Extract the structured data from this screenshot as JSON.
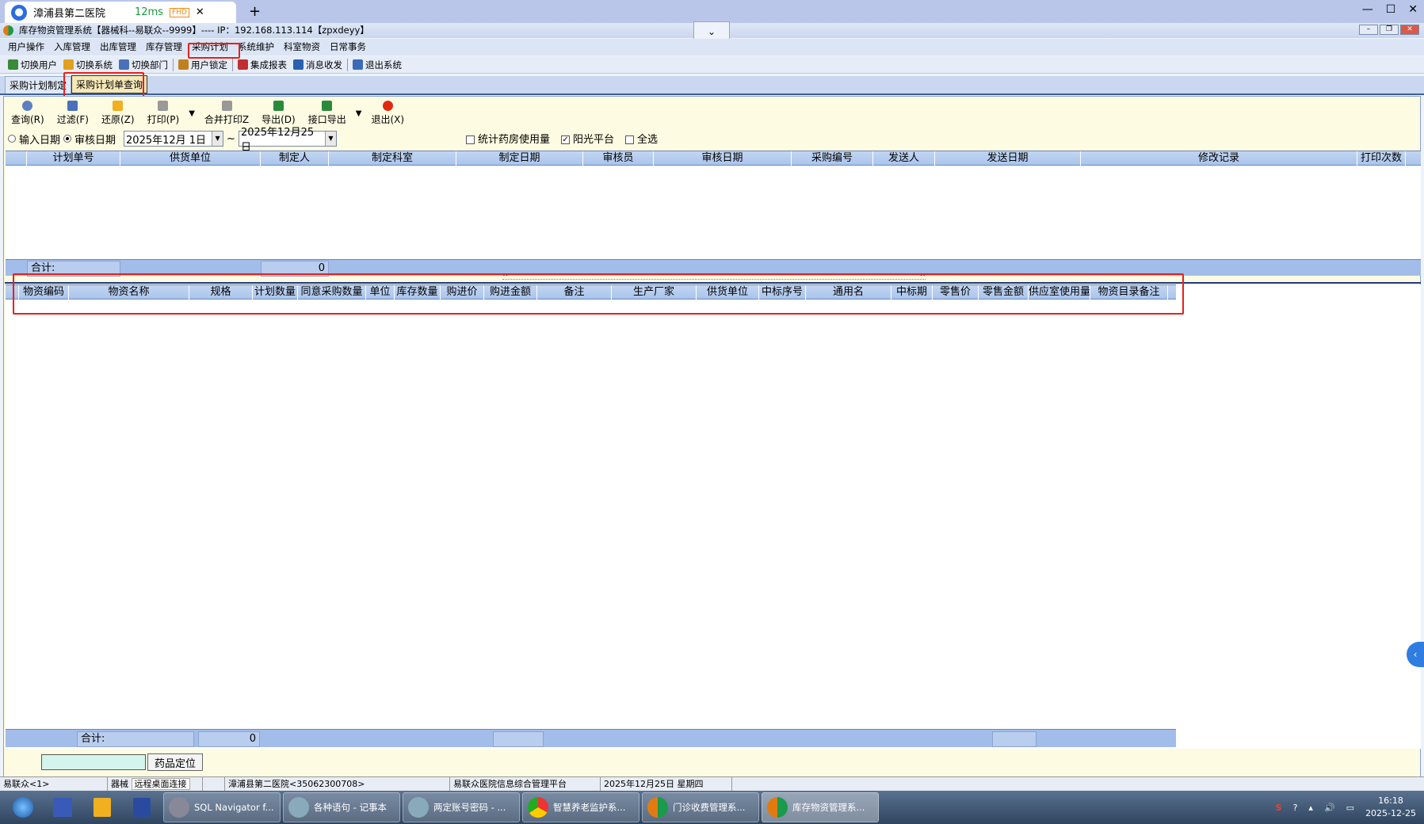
{
  "browser": {
    "tab_title": "漳浦县第二医院",
    "ping": "12ms",
    "quality_badge": "FHD",
    "close": "✕",
    "new_tab": "+",
    "window_controls": [
      "—",
      "☐",
      "✕"
    ]
  },
  "app": {
    "title": "库存物资管理系统【器械科--易联众--9999】---- IP：192.168.113.114【zpxdeyy】",
    "dropdown_icon": "chevron-down"
  },
  "menubar": [
    "用户操作",
    "入库管理",
    "出库管理",
    "库存管理",
    "采购计划",
    "系统维护",
    "科室物资",
    "日常事务"
  ],
  "toolbar1": [
    "切换用户",
    "切换系统",
    "切换部门",
    "用户锁定",
    "集成报表",
    "消息收发",
    "退出系统"
  ],
  "tabs": [
    "采购计划制定",
    "采购计划单查询"
  ],
  "active_tab": 1,
  "toolbar2": {
    "query": "查询(R)",
    "filter": "过滤(F)",
    "restore": "还原(Z)",
    "print": "打印(P)",
    "merge_print": "合并打印Z",
    "export": "导出(D)",
    "api_export": "接口导出",
    "exit": "退出(X)"
  },
  "date_filter": {
    "input_date": "输入日期",
    "audit_date": "审核日期",
    "selected": "审核日期",
    "from": "2025年12月 1日",
    "sep": "~",
    "to": "2025年12月25日"
  },
  "checks": {
    "pharmacy_usage": {
      "label": "统计药房使用量",
      "checked": false
    },
    "sunshine": {
      "label": "阳光平台",
      "checked": true
    },
    "select_all": {
      "label": "全选",
      "checked": false
    }
  },
  "grid1": {
    "columns": [
      "",
      "计划单号",
      "供货单位",
      "制定人",
      "制定科室",
      "制定日期",
      "审核员",
      "审核日期",
      "采购编号",
      "发送人",
      "发送日期",
      "修改记录",
      "打印次数"
    ],
    "rows": [],
    "sum_label": "合计:",
    "sum_value": "0"
  },
  "grid2": {
    "columns": [
      "",
      "物资编码",
      "物资名称",
      "规格",
      "计划数量",
      "同意采购数量",
      "单位",
      "库存数量",
      "购进价",
      "购进金额",
      "备注",
      "生产厂家",
      "供货单位",
      "中标序号",
      "通用名",
      "中标期",
      "零售价",
      "零售金额",
      "供应室使用量",
      "物资目录备注"
    ],
    "rows": [],
    "sum_label": "合计:",
    "sum_value": "0"
  },
  "bottom": {
    "locate_value": "",
    "locate_button": "药品定位"
  },
  "status": [
    "易联众<1>",
    "器械",
    "远程桌面连接",
    "漳浦县第二医院<35062300708>",
    "易联众医院信息综合管理平台",
    "2025年12月25日 星期四",
    ""
  ],
  "taskbar": {
    "items": [
      "SQL Navigator f...",
      "各种语句 - 记事本",
      "两定账号密码 - ...",
      "智慧养老监护系...",
      "门诊收费管理系...",
      "库存物资管理系..."
    ],
    "active": 5,
    "time": "16:18",
    "date": "2025-12-25"
  },
  "colors": {
    "highlight": "#e8201c",
    "header": "#aac4ec",
    "panel": "#fdfbe1"
  }
}
